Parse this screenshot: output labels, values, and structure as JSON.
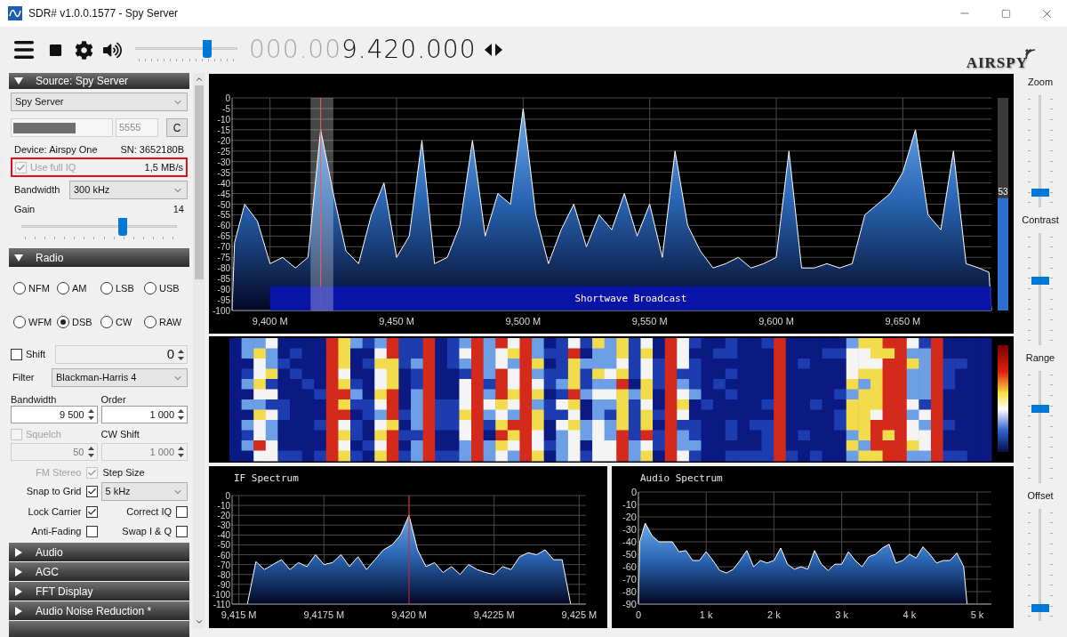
{
  "window": {
    "title": "SDR# v1.0.0.1577 - Spy Server"
  },
  "toolbar": {
    "volume": {
      "level": 0.7
    },
    "frequency_dim": "000.00",
    "frequency": "9.420.000"
  },
  "logo": "AIRSPY",
  "source_panel": {
    "header": "Source: Spy Server",
    "expanded": true,
    "source": "Spy Server",
    "port": "5555",
    "connect_button": "C",
    "device": "Device: Airspy One",
    "serial": "SN: 3652180B",
    "full_iq": {
      "label": "Use full IQ",
      "checked": true,
      "disabled": true,
      "highlighted": true
    },
    "rate": "1,5 MB/s",
    "bandwidth_label": "Bandwidth",
    "bandwidth": "300 kHz",
    "gain_label": "Gain",
    "gain_value": "14",
    "gain": {
      "level": 0.65
    }
  },
  "radio_panel": {
    "header": "Radio",
    "expanded": true,
    "modes": [
      {
        "label": "NFM",
        "selected": false
      },
      {
        "label": "AM",
        "selected": false
      },
      {
        "label": "LSB",
        "selected": false
      },
      {
        "label": "USB",
        "selected": false
      },
      {
        "label": "WFM",
        "selected": false
      },
      {
        "label": "DSB",
        "selected": true
      },
      {
        "label": "CW",
        "selected": false
      },
      {
        "label": "RAW",
        "selected": false
      }
    ],
    "shift": {
      "label": "Shift",
      "checked": false,
      "value": "0"
    },
    "filter_label": "Filter",
    "filter": "Blackman-Harris 4",
    "bandwidth_label": "Bandwidth",
    "bandwidth": "9 500",
    "order_label": "Order",
    "order": "1 000",
    "squelch": {
      "label": "Squelch",
      "checked": false,
      "disabled": true
    },
    "squelch_value": "50",
    "cw_shift_label": "CW Shift",
    "cw_shift": "1 000",
    "fm_stereo": {
      "label": "FM Stereo",
      "checked": true,
      "disabled": true
    },
    "step_size_label": "Step Size",
    "snap_to_grid": {
      "label": "Snap to Grid",
      "checked": true
    },
    "step_size": "5 kHz",
    "lock_carrier": {
      "label": "Lock Carrier",
      "checked": true
    },
    "correct_iq": {
      "label": "Correct IQ",
      "checked": false
    },
    "anti_fading": {
      "label": "Anti-Fading",
      "checked": false
    },
    "swap_iq": {
      "label": "Swap I & Q",
      "checked": false
    }
  },
  "collapsed_panels": [
    {
      "header": "Audio",
      "expanded": false
    },
    {
      "header": "AGC",
      "expanded": false
    },
    {
      "header": "FFT Display",
      "expanded": false
    },
    {
      "header": "Audio Noise Reduction *",
      "expanded": false
    }
  ],
  "spectrum": {
    "meter": {
      "level": 0.53,
      "reading": "53"
    },
    "chart_data": {
      "type": "area",
      "x": [
        9385,
        9386,
        9390,
        9395,
        9400,
        9405,
        9410,
        9415,
        9420,
        9425,
        9430,
        9435,
        9440,
        9445,
        9450,
        9455,
        9460,
        9465,
        9470,
        9475,
        9480,
        9485,
        9490,
        9495,
        9500,
        9505,
        9510,
        9515,
        9520,
        9525,
        9530,
        9535,
        9540,
        9545,
        9550,
        9555,
        9560,
        9565,
        9570,
        9575,
        9580,
        9585,
        9590,
        9595,
        9600,
        9605,
        9610,
        9615,
        9620,
        9625,
        9630,
        9635,
        9640,
        9645,
        9650,
        9655,
        9660,
        9665,
        9670,
        9675,
        9680,
        9684,
        9685
      ],
      "series": [
        {
          "color": "#ffffff",
          "values": [
            -100,
            -68,
            -50,
            -58,
            -78,
            -75,
            -80,
            -75,
            -15,
            -45,
            -72,
            -78,
            -55,
            -40,
            -75,
            -65,
            -20,
            -78,
            -75,
            -60,
            -20,
            -65,
            -45,
            -50,
            -5,
            -55,
            -78,
            -62,
            -50,
            -70,
            -55,
            -62,
            -45,
            -65,
            -50,
            -75,
            -25,
            -60,
            -72,
            -80,
            -78,
            -75,
            -80,
            -78,
            -75,
            -25,
            -80,
            -80,
            -78,
            -80,
            -78,
            -55,
            -50,
            -45,
            -35,
            -15,
            -55,
            -62,
            -25,
            -78,
            -80,
            -82,
            -100
          ]
        }
      ],
      "xlim": [
        9385,
        9685
      ],
      "ylim": [
        -100,
        0
      ],
      "xticks": [
        {
          "value": 9400,
          "label": "9,400 M"
        },
        {
          "value": 9450,
          "label": "9,450 M"
        },
        {
          "value": 9500,
          "label": "9,500 M"
        },
        {
          "value": 9550,
          "label": "9,550 M"
        },
        {
          "value": 9600,
          "label": "9,600 M"
        },
        {
          "value": 9650,
          "label": "9,650 M"
        }
      ],
      "yticks": [
        0,
        -5,
        -10,
        -15,
        -20,
        -25,
        -30,
        -35,
        -40,
        -45,
        -50,
        -55,
        -60,
        -65,
        -70,
        -75,
        -80,
        -85,
        -90,
        -95,
        -100
      ],
      "grid": true,
      "ref_lines": [
        {
          "axis": "x",
          "value": 9420
        }
      ]
    },
    "band_label": "Shortwave Broadcast"
  },
  "if_spectrum": {
    "chart_data": {
      "type": "area",
      "title": "IF Spectrum",
      "x": [
        9415.25,
        9415.5,
        9415.75,
        9416,
        9416.25,
        9416.5,
        9416.75,
        9417,
        9417.25,
        9417.5,
        9417.75,
        9418,
        9418.25,
        9418.5,
        9418.75,
        9419,
        9419.25,
        9419.5,
        9419.75,
        9420,
        9420.25,
        9420.5,
        9420.75,
        9421,
        9421.25,
        9421.5,
        9421.75,
        9422,
        9422.25,
        9422.5,
        9422.75,
        9423,
        9423.25,
        9423.5,
        9423.75,
        9424,
        9424.25,
        9424.5,
        9424.75
      ],
      "series": [
        {
          "color": "#ffffff",
          "values": [
            -110,
            -67,
            -75,
            -70,
            -65,
            -75,
            -68,
            -72,
            -60,
            -70,
            -68,
            -60,
            -72,
            -62,
            -75,
            -65,
            -55,
            -50,
            -40,
            -20,
            -55,
            -72,
            -68,
            -78,
            -72,
            -80,
            -70,
            -75,
            -78,
            -80,
            -72,
            -75,
            -62,
            -58,
            -60,
            -55,
            -65,
            -65,
            -110
          ]
        }
      ],
      "xlim": [
        9414.8,
        9425.2
      ],
      "ylim": [
        -110,
        0
      ],
      "xticks": [
        {
          "value": 9415,
          "label": "9,415 M"
        },
        {
          "value": 9417.5,
          "label": "9,4175 M"
        },
        {
          "value": 9420,
          "label": "9,420 M"
        },
        {
          "value": 9422.5,
          "label": "9,4225 M"
        },
        {
          "value": 9425,
          "label": "9,425 M"
        }
      ],
      "yticks": [
        0,
        -10,
        -20,
        -30,
        -40,
        -50,
        -60,
        -70,
        -80,
        -90,
        -100,
        -110
      ],
      "grid": true,
      "ref_lines": [
        {
          "axis": "x",
          "value": 9420
        }
      ]
    }
  },
  "audio_spectrum": {
    "chart_data": {
      "type": "area",
      "title": "Audio Spectrum",
      "x": [
        0,
        20,
        100,
        200,
        300,
        400,
        500,
        600,
        700,
        800,
        900,
        1000,
        1100,
        1200,
        1300,
        1400,
        1500,
        1600,
        1700,
        1800,
        1900,
        2000,
        2100,
        2200,
        2300,
        2400,
        2500,
        2600,
        2700,
        2800,
        2900,
        3000,
        3100,
        3200,
        3300,
        3400,
        3500,
        3600,
        3700,
        3800,
        3900,
        4000,
        4100,
        4200,
        4300,
        4400,
        4500,
        4600,
        4700,
        4800,
        4850
      ],
      "series": [
        {
          "color": "#ffffff",
          "values": [
            -90,
            -40,
            -25,
            -35,
            -40,
            -40,
            -40,
            -48,
            -47,
            -55,
            -55,
            -48,
            -55,
            -63,
            -65,
            -62,
            -55,
            -47,
            -60,
            -55,
            -57,
            -55,
            -45,
            -58,
            -62,
            -60,
            -62,
            -47,
            -58,
            -63,
            -58,
            -58,
            -48,
            -55,
            -60,
            -52,
            -50,
            -45,
            -42,
            -57,
            -55,
            -50,
            -53,
            -44,
            -50,
            -57,
            -55,
            -55,
            -49,
            -60,
            -90
          ]
        }
      ],
      "xlim": [
        0,
        5210
      ],
      "ylim": [
        -90,
        0
      ],
      "xticks": [
        {
          "value": 0,
          "label": "0"
        },
        {
          "value": 1000,
          "label": "1 k"
        },
        {
          "value": 2000,
          "label": "2 k"
        },
        {
          "value": 3000,
          "label": "3 k"
        },
        {
          "value": 4000,
          "label": "4 k"
        },
        {
          "value": 5000,
          "label": "5 k"
        }
      ],
      "yticks": [
        0,
        -10,
        -20,
        -30,
        -40,
        -50,
        -60,
        -70,
        -80,
        -90
      ],
      "grid": true
    }
  },
  "display_sliders": [
    {
      "label": "Zoom",
      "level": 0.1
    },
    {
      "label": "Contrast",
      "level": 0.58
    },
    {
      "label": "Range",
      "level": 0.67
    },
    {
      "label": "Offset",
      "level": 0.08
    }
  ]
}
